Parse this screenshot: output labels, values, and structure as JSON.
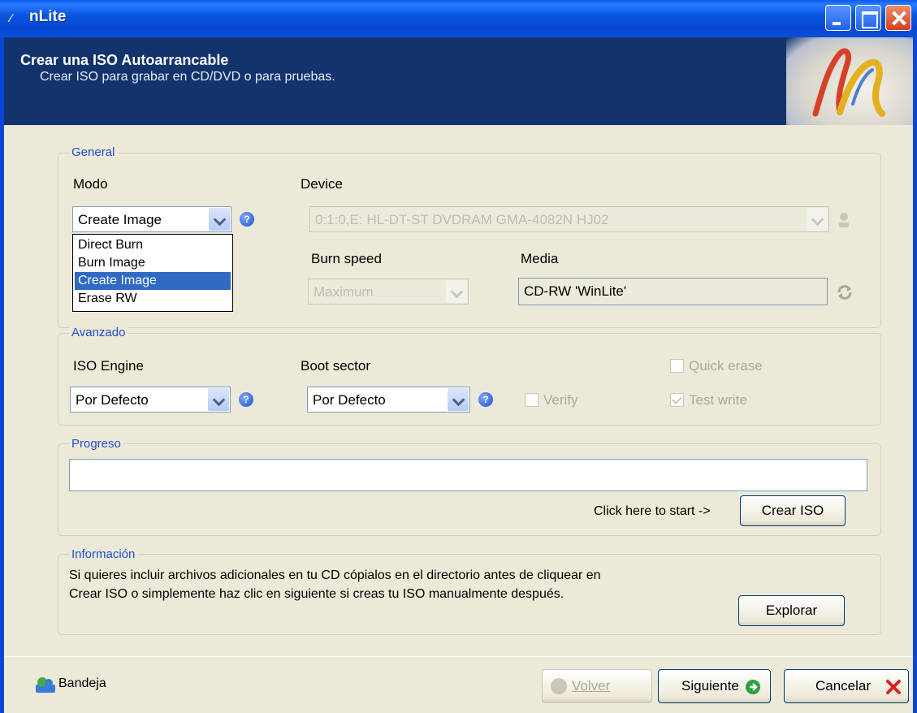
{
  "window": {
    "title": "nLite",
    "controls": [
      "minimize",
      "maximize",
      "close"
    ]
  },
  "header": {
    "title": "Crear una ISO Autoarrancable",
    "subtitle": "Crear ISO para grabar en CD/DVD o para pruebas."
  },
  "general": {
    "group_label": "General",
    "modo_label": "Modo",
    "modo_value": "Create Image",
    "modo_options": [
      "Direct Burn",
      "Burn Image",
      "Create Image",
      "Erase RW"
    ],
    "modo_selected_index": 2,
    "device_label": "Device",
    "device_value": "0:1:0,E: HL-DT-ST DVDRAM GMA-4082N HJ02",
    "burn_speed_label": "Burn speed",
    "burn_speed_value": "Maximum",
    "media_label": "Media",
    "media_value": "CD-RW 'WinLite'"
  },
  "avanzado": {
    "group_label": "Avanzado",
    "iso_engine_label": "ISO Engine",
    "iso_engine_value": "Por Defecto",
    "boot_sector_label": "Boot sector",
    "boot_sector_value": "Por Defecto",
    "verify_label": "Verify",
    "verify_checked": false,
    "quick_erase_label": "Quick erase",
    "quick_erase_checked": false,
    "test_write_label": "Test write",
    "test_write_checked": true
  },
  "progreso": {
    "group_label": "Progreso",
    "progress_value": 0,
    "start_hint": "Click here to start ->",
    "crear_iso_button": "Crear ISO"
  },
  "informacion": {
    "group_label": "Información",
    "text_line1": "Si quieres incluir archivos adicionales en tu CD cópialos en el directorio antes de cliquear en",
    "text_line2": "Crear ISO o simplemente haz clic en siguiente si creas tu ISO manualmente después.",
    "explorar_button": "Explorar"
  },
  "footer": {
    "bandeja_label": "Bandeja",
    "volver_button": "Volver",
    "siguiente_button": "Siguiente",
    "cancelar_button": "Cancelar"
  },
  "colors": {
    "titlebar": "#0a4fd8",
    "banner": "#12336c",
    "group_label": "#1d4fd0",
    "selection": "#316ac5",
    "dialog_bg": "#ece9d8"
  }
}
